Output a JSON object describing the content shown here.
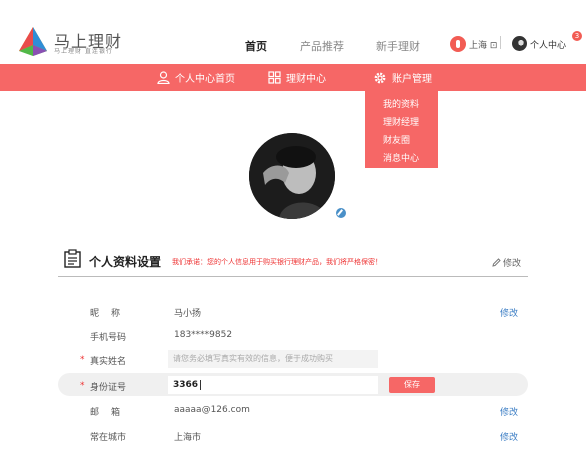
{
  "header": {
    "logo_title": "马上理财",
    "logo_subtitle": "马上理财 直连银行",
    "nav": [
      {
        "label": "首页",
        "active": true
      },
      {
        "label": "产品推荐",
        "active": false
      },
      {
        "label": "新手理财",
        "active": false
      }
    ],
    "location": "上海",
    "user_label": "个人中心",
    "notification_count": "3"
  },
  "menu": {
    "items": [
      {
        "label": "个人中心首页",
        "icon": "user-icon"
      },
      {
        "label": "理财中心",
        "icon": "grid-icon"
      },
      {
        "label": "账户管理",
        "icon": "gear-icon"
      }
    ],
    "dropdown": [
      "我的资料",
      "理财经理",
      "财友圈",
      "消息中心"
    ]
  },
  "profile": {
    "section_title": "个人资料设置",
    "notice": "我们承诺：您的个人信息用于购买银行理财产品，我们将严格保密！",
    "edit_label": "修改",
    "rows": [
      {
        "label": "昵称",
        "value": "马小扬",
        "action": "修改"
      },
      {
        "label": "手机号码",
        "value": "183****9852"
      },
      {
        "label": "真实姓名",
        "placeholder": "请您务必填写真实有效的信息，便于成功购买"
      },
      {
        "label": "身份证号",
        "value": "3366",
        "action": "保存"
      },
      {
        "label": "邮箱",
        "value": "aaaaa@126.com",
        "action": "修改"
      },
      {
        "label": "常在城市",
        "value": "上海市",
        "action": "修改"
      }
    ]
  },
  "colors": {
    "brand_red": "#f66766",
    "link_blue": "#3b7dc4",
    "required_star": "#e33333"
  }
}
